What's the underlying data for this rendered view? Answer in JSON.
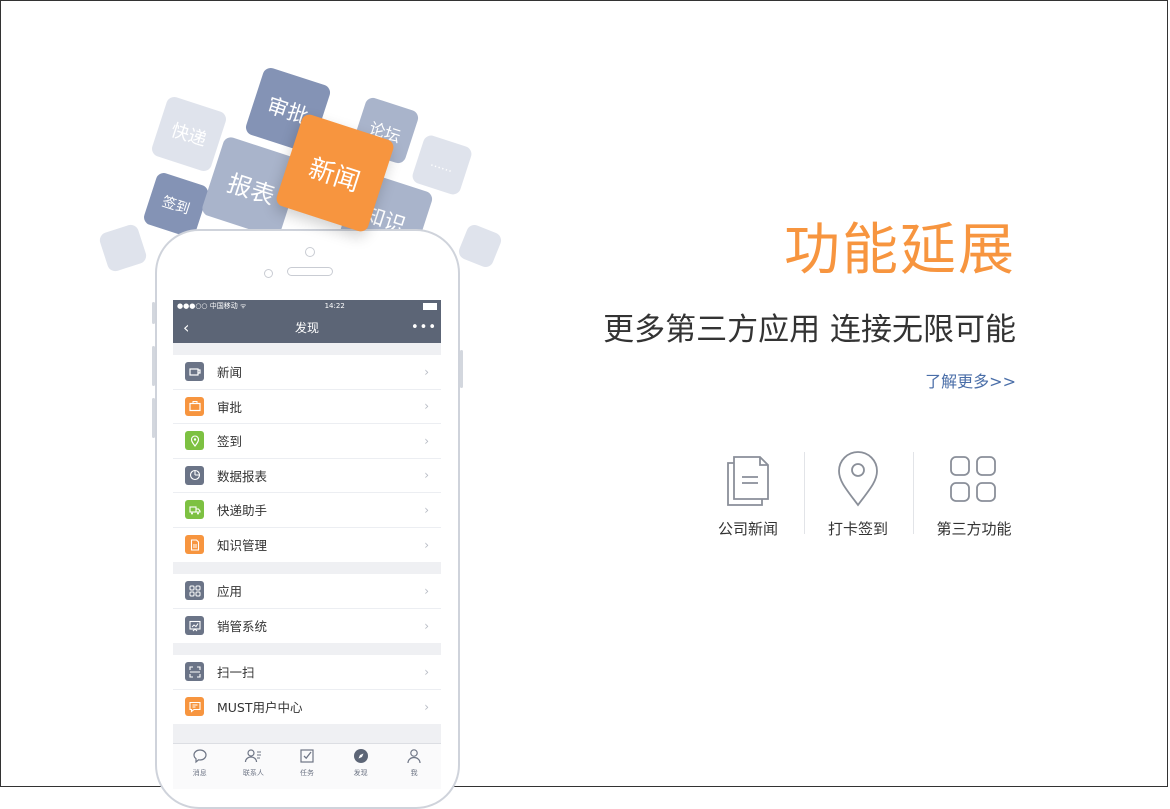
{
  "tiles": {
    "kuaidi": "快递",
    "shenpi": "审批",
    "luntan": "论坛",
    "xinwen": "新闻",
    "baobiao": "报表",
    "qiandao": "签到",
    "zhishi": "知识",
    "more": "......"
  },
  "phone": {
    "status": {
      "carrier": "●●●○○ 中国移动 ᯤ",
      "time": "14:22"
    },
    "nav": {
      "back": "‹",
      "title": "发现",
      "more": "•••"
    },
    "groups": [
      [
        {
          "label": "新闻",
          "icon": "cup-icon",
          "color": "#6b7487"
        },
        {
          "label": "审批",
          "icon": "briefcase-icon",
          "color": "#f7953f"
        },
        {
          "label": "签到",
          "icon": "location-pin-icon",
          "color": "#7dc142"
        },
        {
          "label": "数据报表",
          "icon": "pie-chart-icon",
          "color": "#6b7487"
        },
        {
          "label": "快递助手",
          "icon": "truck-icon",
          "color": "#7dc142"
        },
        {
          "label": "知识管理",
          "icon": "document-icon",
          "color": "#f7953f"
        }
      ],
      [
        {
          "label": "应用",
          "icon": "grid-icon",
          "color": "#6b7487"
        },
        {
          "label": "销管系统",
          "icon": "chart-board-icon",
          "color": "#6b7487"
        }
      ],
      [
        {
          "label": "扫一扫",
          "icon": "scan-icon",
          "color": "#6b7487"
        },
        {
          "label": "MUST用户中心",
          "icon": "message-icon",
          "color": "#f7953f"
        }
      ]
    ],
    "tabs": [
      {
        "label": "消息",
        "icon": "chat-bubble-icon"
      },
      {
        "label": "联系人",
        "icon": "contacts-icon"
      },
      {
        "label": "任务",
        "icon": "task-check-icon"
      },
      {
        "label": "发现",
        "icon": "compass-icon"
      },
      {
        "label": "我",
        "icon": "person-icon"
      }
    ]
  },
  "hero": {
    "headline": "功能延展",
    "subline": "更多第三方应用 连接无限可能",
    "learn_more": "了解更多>>"
  },
  "features": [
    {
      "label": "公司新闻",
      "icon": "documents-icon"
    },
    {
      "label": "打卡签到",
      "icon": "map-pin-icon"
    },
    {
      "label": "第三方功能",
      "icon": "four-squares-icon"
    }
  ]
}
